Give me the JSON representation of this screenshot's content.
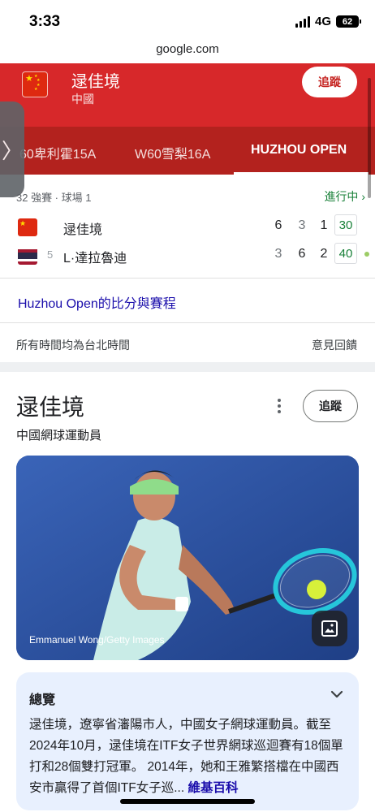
{
  "status": {
    "time": "3:33",
    "network": "4G",
    "battery": "62"
  },
  "browser": {
    "url": "google.com"
  },
  "header": {
    "player_name": "逯佳境",
    "country": "中國",
    "follow_label": "追蹤",
    "tabs": [
      {
        "label": "60卑利霍15A"
      },
      {
        "label": "W60雪梨16A"
      },
      {
        "label": "HUZHOU OPEN"
      }
    ],
    "active_tab": "HUZHOU OPEN"
  },
  "match": {
    "round": "32 強賽 · 球場 1",
    "status": "進行中",
    "players": [
      {
        "seed": "",
        "name": "逯佳境",
        "sets": [
          "6",
          "3",
          "1"
        ],
        "points": "30",
        "serving": false
      },
      {
        "seed": "5",
        "name": "L·達拉魯迪",
        "sets": [
          "3",
          "6",
          "2"
        ],
        "points": "40",
        "serving": true
      }
    ],
    "scores_link": "Huzhou Open的比分與賽程",
    "timezone_note": "所有時間均為台北時間",
    "feedback": "意見回饋"
  },
  "knowledge_panel": {
    "title": "逯佳境",
    "subtitle": "中國網球運動員",
    "follow_label": "追蹤",
    "photo_credit": "Emmanuel Wong/Getty Images",
    "overview_title": "總覽",
    "overview_text": "逯佳境，遼寧省瀋陽市人，中國女子網球運動員。截至2024年10月，逯佳境在ITF女子世界網球巡迴賽有18個單打和28個雙打冠軍。 2014年，她和王雅繁搭檔在中國西安市贏得了首個ITF女子巡...",
    "overview_source": " 維基百科"
  },
  "colors": {
    "header_red": "#d7282a",
    "tab_red": "#b3221e",
    "live_green": "#188038",
    "link_blue": "#1a0dab",
    "overview_bg": "#e8f0fe"
  }
}
